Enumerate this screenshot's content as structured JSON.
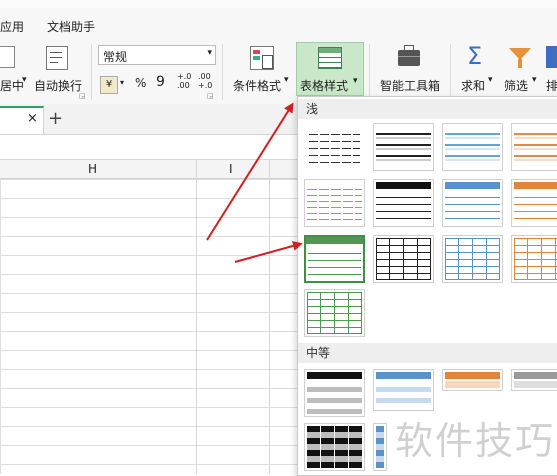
{
  "menu": {
    "items": [
      "应用",
      "文档助手"
    ]
  },
  "ribbon": {
    "merge_label": "居中",
    "wrap_label": "自动换行",
    "number_format": "常规",
    "percent": "%",
    "comma": "9",
    "inc_decimal": "+.0\n.00",
    "dec_decimal": ".00\n+.0",
    "conditional_label": "条件格式",
    "table_style_label": "表格样式",
    "toolbox_label": "智能工具箱",
    "sum_label": "求和",
    "filter_label": "筛选",
    "sort_label": "排"
  },
  "tabbar": {
    "close": "×",
    "add": "+"
  },
  "columns": [
    "H",
    "I"
  ],
  "panel": {
    "section_light": "浅",
    "section_medium": "中等"
  },
  "watermark": "软件技巧",
  "colors": {
    "accent": "#2e9f5f",
    "arrow": "#d02020",
    "selected_ribbon": "#c9e7c9"
  }
}
